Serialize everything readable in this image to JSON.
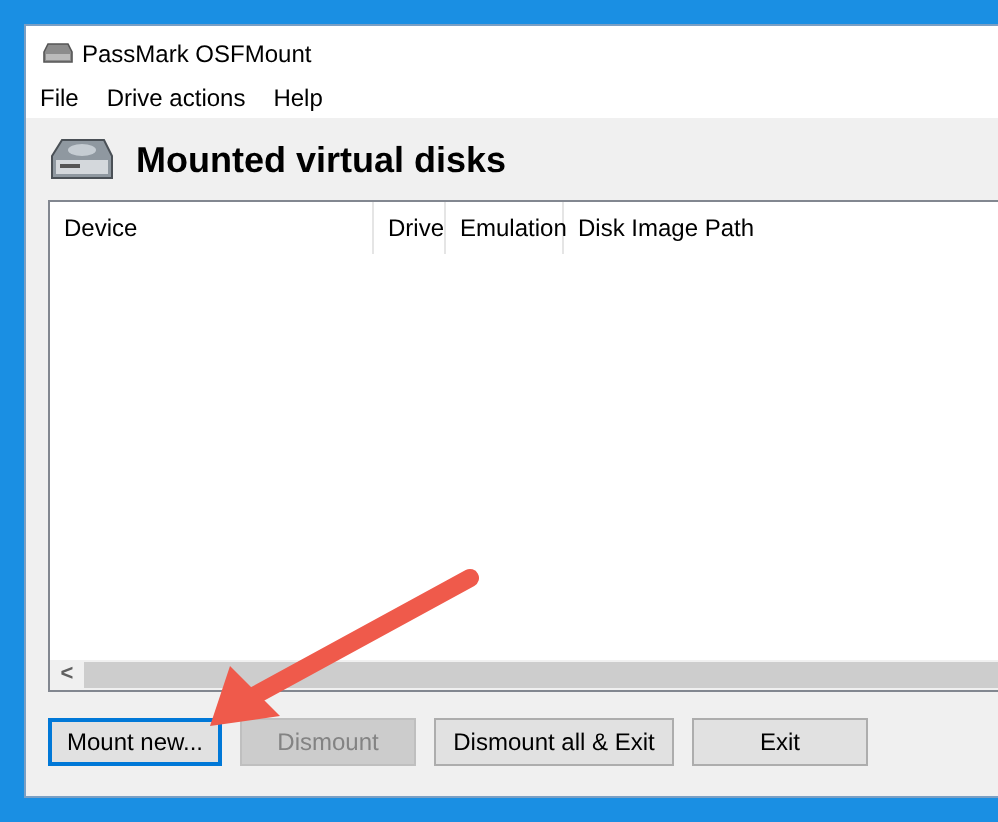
{
  "window": {
    "title": "PassMark OSFMount"
  },
  "menu": [
    "File",
    "Drive actions",
    "Help"
  ],
  "heading": "Mounted virtual disks",
  "table": {
    "columns": [
      "Device",
      "Drive",
      "Emulation",
      "Disk Image Path"
    ],
    "scroll_left": "<"
  },
  "buttons": [
    {
      "label": "Mount new...",
      "focused": true,
      "disabled": false
    },
    {
      "label": "Dismount",
      "focused": false,
      "disabled": true
    },
    {
      "label": "Dismount all & Exit",
      "focused": false,
      "disabled": false
    },
    {
      "label": "Exit",
      "focused": false,
      "disabled": false
    }
  ],
  "annotation": {
    "kind": "arrow"
  }
}
